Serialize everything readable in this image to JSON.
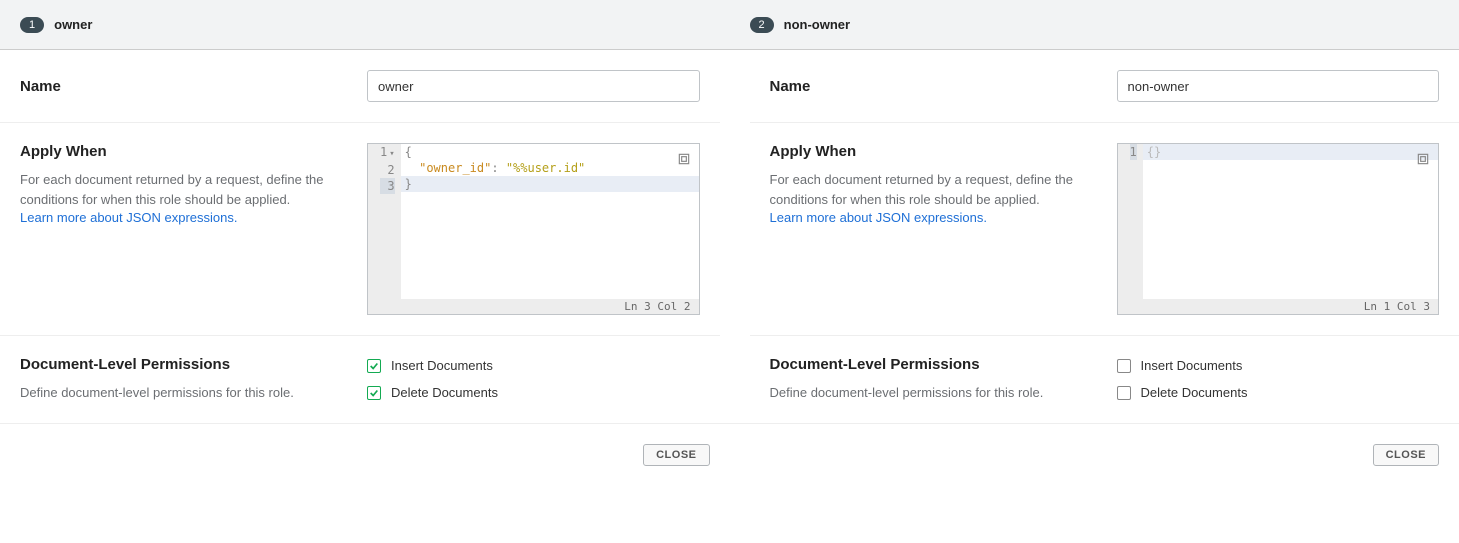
{
  "tabs": [
    {
      "num": "1",
      "label": "owner"
    },
    {
      "num": "2",
      "label": "non-owner"
    }
  ],
  "labels": {
    "name": "Name",
    "apply_when": "Apply When",
    "apply_when_desc": "For each document returned by a request, define the conditions for when this role should be applied.",
    "learn_more": "Learn more about JSON expressions.",
    "doc_perms": "Document-Level Permissions",
    "doc_perms_desc": "Define document-level permissions for this role.",
    "insert": "Insert Documents",
    "delete": "Delete Documents",
    "close": "CLOSE"
  },
  "left": {
    "name_value": "owner",
    "code": {
      "lines": [
        "1",
        "2",
        "3"
      ],
      "l1_brace": "{",
      "l2_indent": "  ",
      "l2_key": "\"owner_id\"",
      "l2_colon": ": ",
      "l2_val": "\"%%user.id\"",
      "l3_brace": "}",
      "status": "Ln 3 Col 2"
    },
    "perms": {
      "insert": true,
      "delete": true
    }
  },
  "right": {
    "name_value": "non-owner",
    "code": {
      "lines": [
        "1"
      ],
      "l1_content": "{}",
      "status": "Ln 1 Col 3"
    },
    "perms": {
      "insert": false,
      "delete": false
    }
  }
}
